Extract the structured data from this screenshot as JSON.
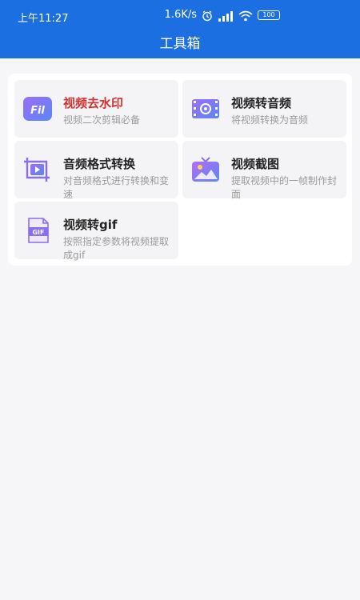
{
  "status": {
    "time": "上午11:27",
    "speed": "1.6K/s",
    "battery": "100",
    "icons": [
      "alarm-icon",
      "signal-icon",
      "wifi-icon",
      "battery-icon"
    ]
  },
  "page": {
    "title": "工具箱"
  },
  "tools": [
    {
      "name": "视频去水印",
      "desc": "视频二次剪辑必备",
      "icon": "video-watermark-icon",
      "highlight": true
    },
    {
      "name": "视频转音频",
      "desc": "将视频转换为音频",
      "icon": "video-to-audio-icon",
      "highlight": false
    },
    {
      "name": "音频格式转换",
      "desc": "对音频格式进行转换和变速",
      "icon": "audio-convert-icon",
      "highlight": false
    },
    {
      "name": "视频截图",
      "desc": "提取视频中的一帧制作封面",
      "icon": "screenshot-icon",
      "highlight": false
    },
    {
      "name": "视频转gif",
      "desc": "按照指定参数将视频提取成gif",
      "icon": "gif-icon",
      "highlight": false
    }
  ],
  "colors": {
    "appbar": "#1c6fe0",
    "highlight_text": "#d0312d",
    "icon_gradient_start": "#8b63f6",
    "icon_gradient_end": "#4e8cf7"
  }
}
